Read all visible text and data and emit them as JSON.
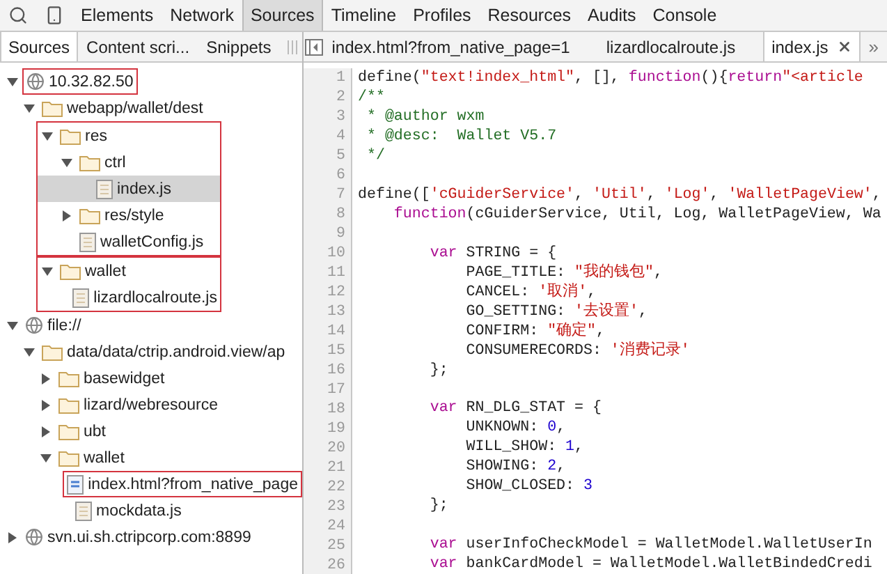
{
  "toolbar": {
    "tabs": [
      {
        "label": "Elements",
        "selected": false
      },
      {
        "label": "Network",
        "selected": false
      },
      {
        "label": "Sources",
        "selected": true
      },
      {
        "label": "Timeline",
        "selected": false
      },
      {
        "label": "Profiles",
        "selected": false
      },
      {
        "label": "Resources",
        "selected": false
      },
      {
        "label": "Audits",
        "selected": false
      },
      {
        "label": "Console",
        "selected": false
      }
    ]
  },
  "navigator": {
    "tabs": [
      {
        "label": "Sources",
        "selected": true
      },
      {
        "label": "Content scri...",
        "selected": false
      },
      {
        "label": "Snippets",
        "selected": false
      }
    ],
    "tree": [
      {
        "kind": "host",
        "label": "10.32.82.50",
        "expanded": true,
        "selected": false,
        "outline_row": true,
        "children": [
          {
            "kind": "folder",
            "label": "webapp/wallet/dest",
            "expanded": true,
            "selected": false,
            "children": [
              {
                "kind": "folder",
                "label": "res",
                "expanded": true,
                "selected": false,
                "outline_group": true,
                "children": [
                  {
                    "kind": "folder",
                    "label": "ctrl",
                    "expanded": true,
                    "selected": false,
                    "children": [
                      {
                        "kind": "file",
                        "label": "index.js",
                        "selected": true
                      }
                    ]
                  },
                  {
                    "kind": "folder",
                    "label": "res/style",
                    "expanded": false,
                    "selected": false
                  },
                  {
                    "kind": "file",
                    "label": "walletConfig.js",
                    "selected": false
                  }
                ]
              },
              {
                "kind": "folder",
                "label": "wallet",
                "expanded": true,
                "selected": false,
                "outline_group": true,
                "children": [
                  {
                    "kind": "file",
                    "label": "lizardlocalroute.js",
                    "selected": false
                  }
                ]
              }
            ]
          }
        ]
      },
      {
        "kind": "host",
        "label": "file://",
        "expanded": true,
        "selected": false,
        "children": [
          {
            "kind": "folder",
            "label": "data/data/ctrip.android.view/ap",
            "expanded": true,
            "selected": false,
            "children": [
              {
                "kind": "folder",
                "label": "basewidget",
                "expanded": false,
                "selected": false
              },
              {
                "kind": "folder",
                "label": "lizard/webresource",
                "expanded": false,
                "selected": false
              },
              {
                "kind": "folder",
                "label": "ubt",
                "expanded": false,
                "selected": false
              },
              {
                "kind": "folder",
                "label": "wallet",
                "expanded": true,
                "selected": false,
                "children": [
                  {
                    "kind": "page",
                    "label": "index.html?from_native_page",
                    "selected": false,
                    "outline_row": true
                  },
                  {
                    "kind": "file",
                    "label": "mockdata.js",
                    "selected": false
                  }
                ]
              }
            ]
          }
        ]
      },
      {
        "kind": "host",
        "label": "svn.ui.sh.ctripcorp.com:8899",
        "expanded": false,
        "selected": false
      }
    ]
  },
  "editor": {
    "tabs": [
      {
        "label": "index.html?from_native_page=1",
        "selected": false,
        "closable": false
      },
      {
        "label": "lizardlocalroute.js",
        "selected": false,
        "closable": false
      },
      {
        "label": "index.js",
        "selected": true,
        "closable": true
      }
    ],
    "overflow": "»",
    "lines": [
      {
        "number": "1",
        "segments": [
          {
            "kind": "plain",
            "text": "define("
          },
          {
            "kind": "string",
            "text": "\"text!index_html\""
          },
          {
            "kind": "plain",
            "text": ", [], "
          },
          {
            "kind": "keyword",
            "text": "function"
          },
          {
            "kind": "plain",
            "text": "(){"
          },
          {
            "kind": "keyword",
            "text": "return"
          },
          {
            "kind": "string",
            "text": "\"<article"
          }
        ]
      },
      {
        "number": "2",
        "segments": [
          {
            "kind": "comment",
            "text": "/**"
          }
        ]
      },
      {
        "number": "3",
        "segments": [
          {
            "kind": "comment",
            "text": " * @author wxm"
          }
        ]
      },
      {
        "number": "4",
        "segments": [
          {
            "kind": "comment",
            "text": " * @desc:  Wallet V5.7"
          }
        ]
      },
      {
        "number": "5",
        "segments": [
          {
            "kind": "comment",
            "text": " */"
          }
        ]
      },
      {
        "number": "6"
      },
      {
        "number": "7",
        "segments": [
          {
            "kind": "plain",
            "text": "define(["
          },
          {
            "kind": "string",
            "text": "'cGuiderService'"
          },
          {
            "kind": "plain",
            "text": ", "
          },
          {
            "kind": "string",
            "text": "'Util'"
          },
          {
            "kind": "plain",
            "text": ", "
          },
          {
            "kind": "string",
            "text": "'Log'"
          },
          {
            "kind": "plain",
            "text": ", "
          },
          {
            "kind": "string",
            "text": "'WalletPageView'"
          },
          {
            "kind": "plain",
            "text": ","
          }
        ]
      },
      {
        "number": "8",
        "segments": [
          {
            "kind": "keyword",
            "text": "    function"
          },
          {
            "kind": "plain",
            "text": "(cGuiderService, Util, Log, WalletPageView, Wa"
          }
        ]
      },
      {
        "number": "9"
      },
      {
        "number": "10",
        "segments": [
          {
            "kind": "keyword",
            "text": "        var"
          },
          {
            "kind": "plain",
            "text": " STRING = {"
          }
        ]
      },
      {
        "number": "11",
        "segments": [
          {
            "kind": "plain",
            "text": "            PAGE_TITLE: "
          },
          {
            "kind": "string",
            "text": "\"我的钱包\""
          },
          {
            "kind": "plain",
            "text": ","
          }
        ]
      },
      {
        "number": "12",
        "segments": [
          {
            "kind": "plain",
            "text": "            CANCEL: "
          },
          {
            "kind": "string",
            "text": "'取消'"
          },
          {
            "kind": "plain",
            "text": ","
          }
        ]
      },
      {
        "number": "13",
        "segments": [
          {
            "kind": "plain",
            "text": "            GO_SETTING: "
          },
          {
            "kind": "string",
            "text": "'去设置'"
          },
          {
            "kind": "plain",
            "text": ","
          }
        ]
      },
      {
        "number": "14",
        "segments": [
          {
            "kind": "plain",
            "text": "            CONFIRM: "
          },
          {
            "kind": "string",
            "text": "\"确定\""
          },
          {
            "kind": "plain",
            "text": ","
          }
        ]
      },
      {
        "number": "15",
        "segments": [
          {
            "kind": "plain",
            "text": "            CONSUMERECORDS: "
          },
          {
            "kind": "string",
            "text": "'消费记录'"
          }
        ]
      },
      {
        "number": "16",
        "segments": [
          {
            "kind": "plain",
            "text": "        };"
          }
        ]
      },
      {
        "number": "17"
      },
      {
        "number": "18",
        "segments": [
          {
            "kind": "keyword",
            "text": "        var"
          },
          {
            "kind": "plain",
            "text": " RN_DLG_STAT = {"
          }
        ]
      },
      {
        "number": "19",
        "segments": [
          {
            "kind": "plain",
            "text": "            UNKNOWN: "
          },
          {
            "kind": "number",
            "text": "0"
          },
          {
            "kind": "plain",
            "text": ","
          }
        ]
      },
      {
        "number": "20",
        "segments": [
          {
            "kind": "plain",
            "text": "            WILL_SHOW: "
          },
          {
            "kind": "number",
            "text": "1"
          },
          {
            "kind": "plain",
            "text": ","
          }
        ]
      },
      {
        "number": "21",
        "segments": [
          {
            "kind": "plain",
            "text": "            SHOWING: "
          },
          {
            "kind": "number",
            "text": "2"
          },
          {
            "kind": "plain",
            "text": ","
          }
        ]
      },
      {
        "number": "22",
        "segments": [
          {
            "kind": "plain",
            "text": "            SHOW_CLOSED: "
          },
          {
            "kind": "number",
            "text": "3"
          }
        ]
      },
      {
        "number": "23",
        "segments": [
          {
            "kind": "plain",
            "text": "        };"
          }
        ]
      },
      {
        "number": "24"
      },
      {
        "number": "25",
        "segments": [
          {
            "kind": "keyword",
            "text": "        var"
          },
          {
            "kind": "plain",
            "text": " userInfoCheckModel = WalletModel.WalletUserIn"
          }
        ]
      },
      {
        "number": "26",
        "segments": [
          {
            "kind": "keyword",
            "text": "        var"
          },
          {
            "kind": "plain",
            "text": " bankCardModel = WalletModel.WalletBindedCredi"
          }
        ]
      }
    ]
  }
}
